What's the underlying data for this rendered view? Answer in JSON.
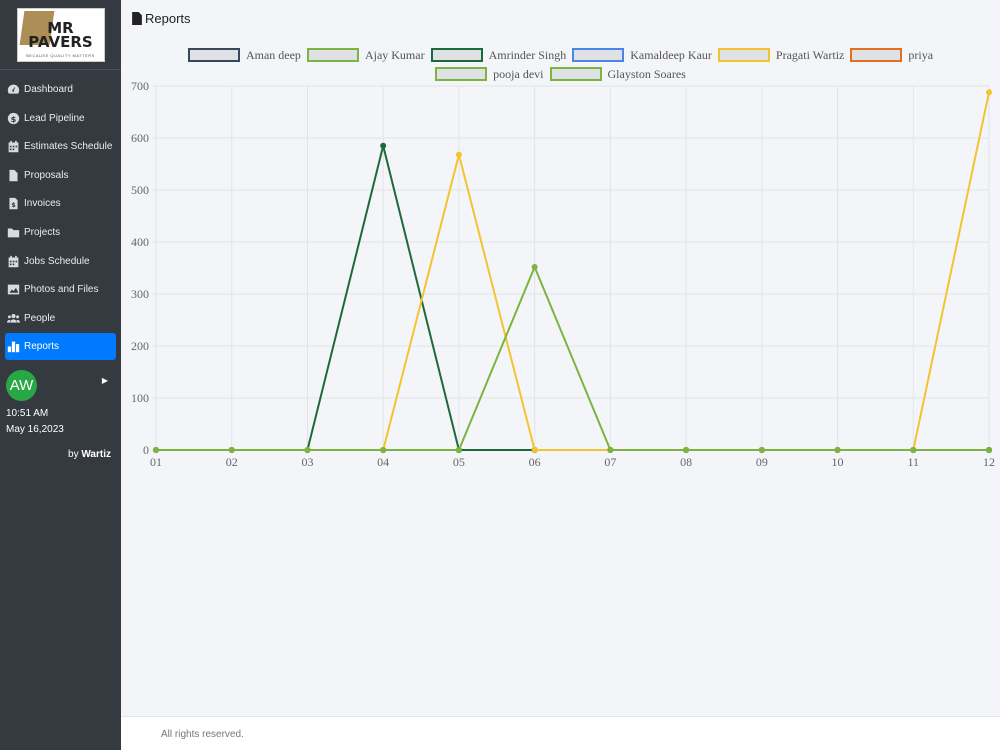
{
  "sidebar": {
    "logo_text": "MR PAVERS",
    "logo_tagline": "BECAUSE QUALITY MATTERS",
    "items": [
      {
        "label": "Dashboard",
        "icon": "dashboard-icon"
      },
      {
        "label": "Lead Pipeline",
        "icon": "dollar-icon"
      },
      {
        "label": "Estimates Schedule",
        "icon": "calendar-icon"
      },
      {
        "label": "Proposals",
        "icon": "file-icon"
      },
      {
        "label": "Invoices",
        "icon": "invoice-icon"
      },
      {
        "label": "Projects",
        "icon": "folder-icon"
      },
      {
        "label": "Jobs Schedule",
        "icon": "calendar-icon"
      },
      {
        "label": "Photos and Files",
        "icon": "image-icon"
      },
      {
        "label": "People",
        "icon": "people-icon"
      },
      {
        "label": "Reports",
        "icon": "chart-icon",
        "active": true
      }
    ],
    "user_initials": "AW",
    "time": "10:51 AM",
    "date": "May 16,2023",
    "by_prefix": "by",
    "by_brand": "Wartiz"
  },
  "page": {
    "title": "Reports"
  },
  "footer": {
    "text": "All rights reserved."
  },
  "chart_data": {
    "type": "line",
    "categories": [
      "01",
      "02",
      "03",
      "04",
      "05",
      "06",
      "07",
      "08",
      "09",
      "10",
      "11",
      "12"
    ],
    "ylim": [
      0,
      700
    ],
    "yticks": [
      0,
      100,
      200,
      300,
      400,
      500,
      600,
      700
    ],
    "grid": true,
    "legend_position": "top",
    "series": [
      {
        "name": "Aman deep",
        "color": "#34495e",
        "values": [
          0,
          0,
          0,
          0,
          0,
          0,
          0,
          0,
          0,
          0,
          0,
          0
        ]
      },
      {
        "name": "Ajay Kumar",
        "color": "#7cb342",
        "values": [
          0,
          0,
          0,
          0,
          0,
          0,
          0,
          0,
          0,
          0,
          0,
          0
        ]
      },
      {
        "name": "Amrinder Singh",
        "color": "#1b6b3a",
        "values": [
          0,
          0,
          0,
          585,
          0,
          0,
          0,
          0,
          0,
          0,
          0,
          0
        ]
      },
      {
        "name": "Kamaldeep Kaur",
        "color": "#4a86e8",
        "values": [
          0,
          0,
          0,
          0,
          0,
          0,
          0,
          0,
          0,
          0,
          0,
          0
        ]
      },
      {
        "name": "Pragati Wartiz",
        "color": "#f4c430",
        "values": [
          0,
          0,
          0,
          0,
          568,
          0,
          0,
          0,
          0,
          0,
          0,
          688
        ]
      },
      {
        "name": "priya",
        "color": "#e07020",
        "values": [
          0,
          0,
          0,
          0,
          0,
          0,
          0,
          0,
          0,
          0,
          0,
          0
        ]
      },
      {
        "name": "pooja devi",
        "color": "#7cb342",
        "values": [
          0,
          0,
          0,
          0,
          0,
          0,
          0,
          0,
          0,
          0,
          0,
          0
        ]
      },
      {
        "name": "Glayston Soares",
        "color": "#7cb342",
        "values": [
          0,
          0,
          0,
          0,
          0,
          352,
          0,
          0,
          0,
          0,
          0,
          0
        ]
      }
    ],
    "legend_rows": [
      [
        0,
        1,
        2,
        3,
        4,
        5
      ],
      [
        6,
        7
      ]
    ]
  }
}
